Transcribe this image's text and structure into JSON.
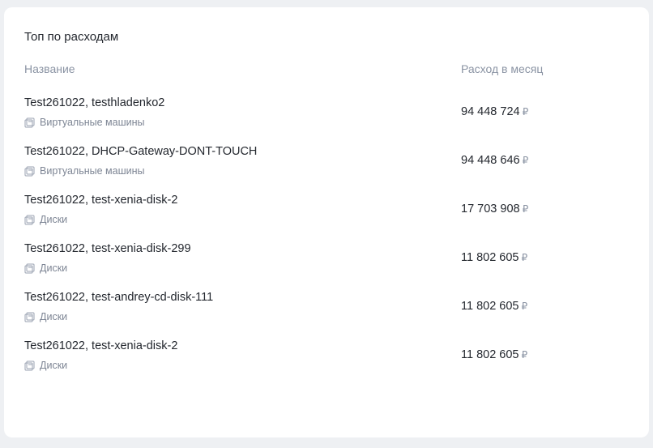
{
  "card": {
    "title": "Топ по расходам",
    "columns": {
      "name": "Название",
      "cost": "Расход в месяц"
    },
    "currency_symbol": "₽",
    "rows": [
      {
        "name": "Test261022, testhladenko2",
        "type": "Виртуальные машины",
        "cost": "94 448 724"
      },
      {
        "name": "Test261022, DHCP-Gateway-DONT-TOUCH",
        "type": "Виртуальные машины",
        "cost": "94 448 646"
      },
      {
        "name": "Test261022, test-xenia-disk-2",
        "type": "Диски",
        "cost": "17 703 908"
      },
      {
        "name": "Test261022, test-xenia-disk-299",
        "type": "Диски",
        "cost": "11 802 605"
      },
      {
        "name": "Test261022, test-andrey-cd-disk-111",
        "type": "Диски",
        "cost": "11 802 605"
      },
      {
        "name": "Test261022, test-xenia-disk-2",
        "type": "Диски",
        "cost": "11 802 605"
      }
    ]
  }
}
